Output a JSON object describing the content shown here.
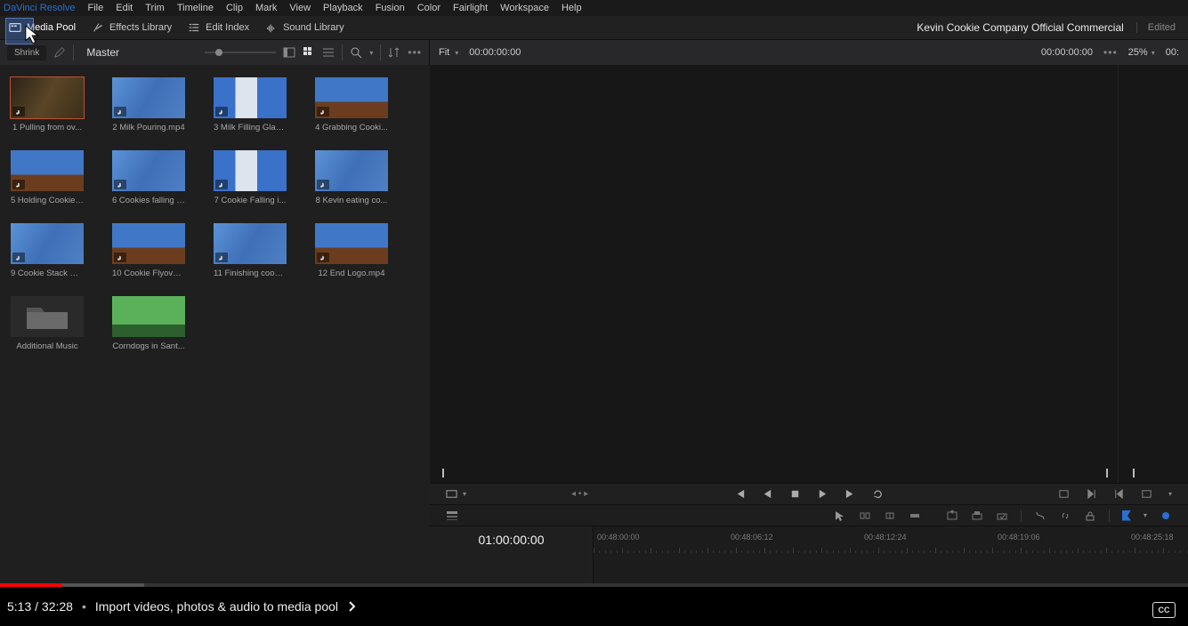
{
  "app_name": "DaVinci Resolve",
  "menus": [
    "File",
    "Edit",
    "Trim",
    "Timeline",
    "Clip",
    "Mark",
    "View",
    "Playback",
    "Fusion",
    "Color",
    "Fairlight",
    "Workspace",
    "Help"
  ],
  "toolbar": {
    "media_pool": "Media Pool",
    "effects_library": "Effects Library",
    "edit_index": "Edit Index",
    "sound_library": "Sound Library"
  },
  "project": {
    "title": "Kevin Cookie Company Official Commercial",
    "status": "Edited"
  },
  "subbar": {
    "shrink": "Shrink",
    "bin": "Master",
    "fit": "Fit",
    "source_tc": "00:00:00:00",
    "record_tc": "00:00:00:00",
    "zoom_pct": "25%",
    "extra_tc": "00:"
  },
  "clips": [
    {
      "name": "1 Pulling from ov...",
      "style": "dark",
      "audio": true,
      "selected": true
    },
    {
      "name": "2 Milk Pouring.mp4",
      "style": "blur",
      "audio": true
    },
    {
      "name": "3 Milk Filling Glas...",
      "style": "glass",
      "audio": true
    },
    {
      "name": "4 Grabbing Cooki...",
      "style": "cookie",
      "audio": true
    },
    {
      "name": "5 Holding Cookie ...",
      "style": "cookie",
      "audio": true
    },
    {
      "name": "6 Cookies falling f...",
      "style": "blur",
      "audio": true
    },
    {
      "name": "7 Cookie Falling i...",
      "style": "glass",
      "audio": true
    },
    {
      "name": "8 Kevin eating co...",
      "style": "blur",
      "audio": true
    },
    {
      "name": "9 Cookie Stack Gr...",
      "style": "blur",
      "audio": true
    },
    {
      "name": "10 Cookie Flyover...",
      "style": "cookie",
      "audio": true
    },
    {
      "name": "11 Finishing cooki...",
      "style": "blur",
      "audio": true
    },
    {
      "name": "12 End Logo.mp4",
      "style": "cookie",
      "audio": true
    },
    {
      "name": "Additional Music",
      "style": "folder",
      "audio": false
    },
    {
      "name": "Corndogs in Sant...",
      "style": "green",
      "audio": false
    }
  ],
  "timeline": {
    "current_tc": "01:00:00:00",
    "ruler": [
      "00:48:00:00",
      "00:48:06:12",
      "00:48:12:24",
      "00:48:19:06",
      "00:48:25:18"
    ]
  },
  "youtube": {
    "time": "5:13 / 32:28",
    "chapter": "Import videos, photos & audio to media pool",
    "cc": "CC"
  }
}
